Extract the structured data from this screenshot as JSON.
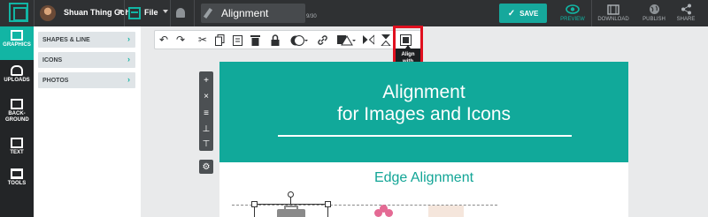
{
  "header": {
    "user_name": "Shuan Thing Goh",
    "file_label": "File",
    "document_title": "Alignment",
    "title_counter": "9/30",
    "save_label": "SAVE",
    "actions": [
      {
        "label": "PREVIEW",
        "icon": "eye-icon",
        "active": true
      },
      {
        "label": "DOWNLOAD",
        "icon": "film-download-icon",
        "active": false
      },
      {
        "label": "PUBLISH",
        "icon": "globe-icon",
        "active": false
      },
      {
        "label": "SHARE",
        "icon": "share-icon",
        "active": false
      }
    ]
  },
  "rail": {
    "items": [
      {
        "label": "GRAPHICS",
        "icon": "image-icon",
        "active": true
      },
      {
        "label": "UPLOADS",
        "icon": "cloud-upload-icon",
        "active": false
      },
      {
        "label": "BACK- GROUND",
        "icon": "background-icon",
        "active": false
      },
      {
        "label": "TEXT",
        "icon": "text-icon",
        "active": false
      },
      {
        "label": "TOOLS",
        "icon": "tools-icon",
        "active": false
      }
    ]
  },
  "subpanel": {
    "items": [
      {
        "label": "SHAPES & LINE"
      },
      {
        "label": "ICONS"
      },
      {
        "label": "PHOTOS"
      }
    ]
  },
  "toolbar": {
    "tools": [
      "undo-icon",
      "redo-icon",
      "cut-icon",
      "copy-icon",
      "paste-icon",
      "delete-icon",
      "lock-icon",
      "color-fill-icon",
      "link-icon",
      "shape-color-icon",
      "flip-horizontal-icon",
      "flip-vertical-icon",
      "align-icon"
    ],
    "tooltip": "Align with other objects"
  },
  "canvas": {
    "heading_line1": "Alignment",
    "heading_line2": "for Images and Icons",
    "subheading": "Edge Alignment",
    "header_color": "#11a99a",
    "accent_color": "#12b5a4"
  }
}
